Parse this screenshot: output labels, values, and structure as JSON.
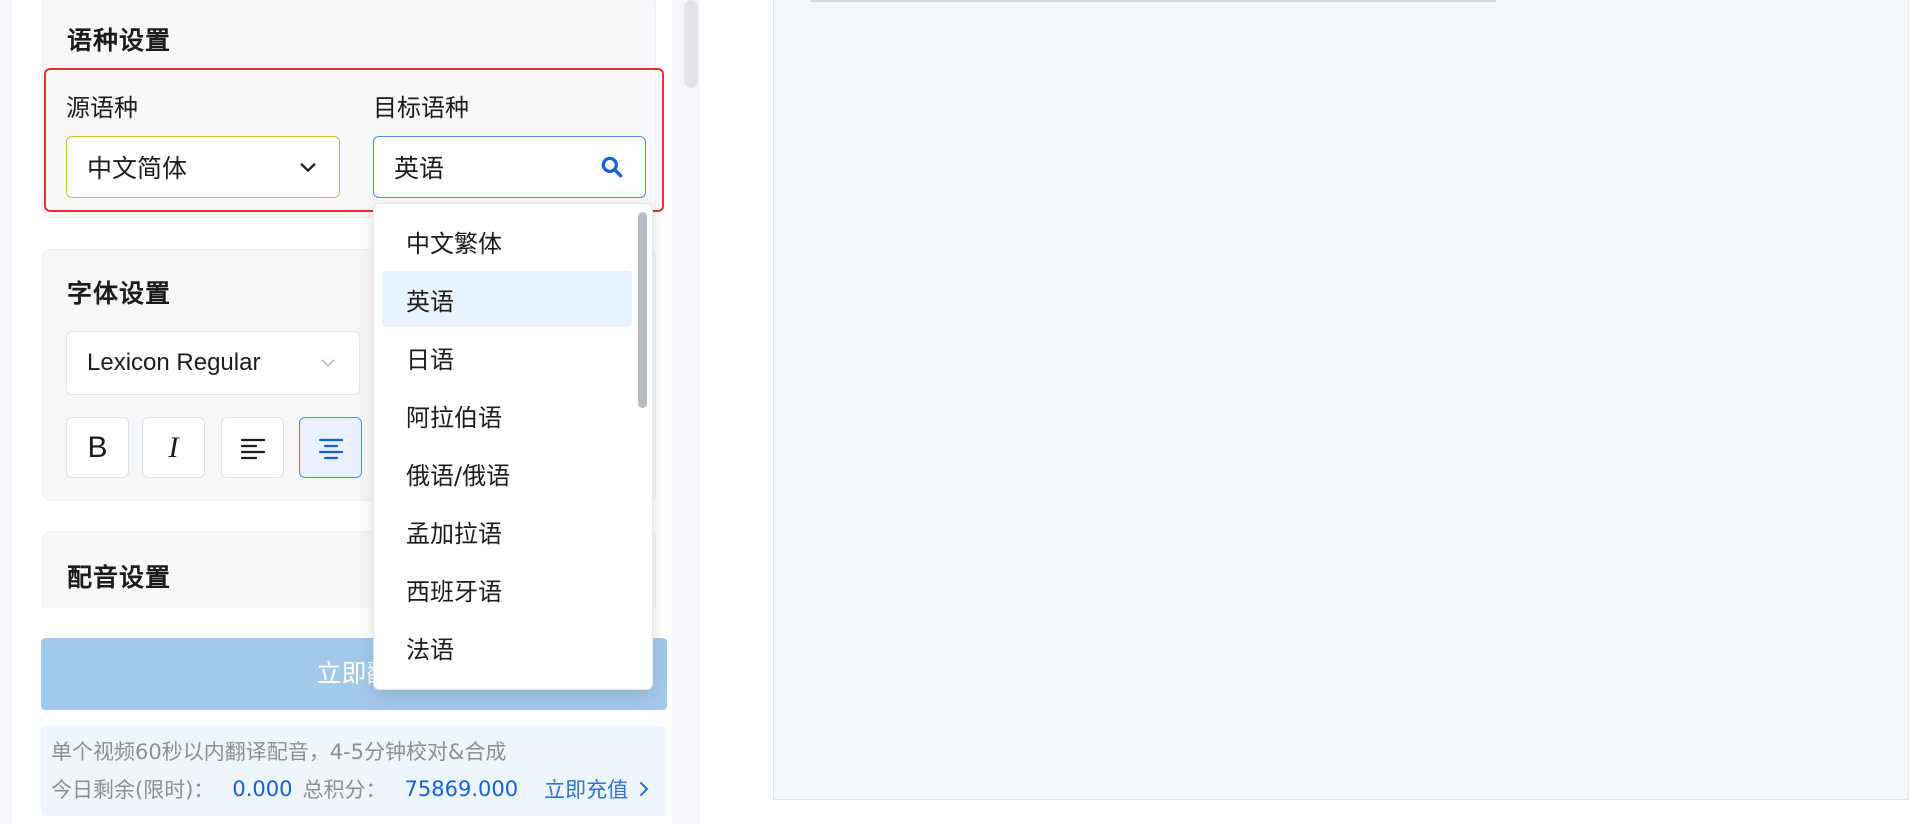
{
  "language_settings": {
    "title": "语种设置",
    "source_label": "源语种",
    "source_value": "中文简体",
    "target_label": "目标语种",
    "target_value": "英语"
  },
  "target_dropdown": {
    "items": [
      "中文繁体",
      "英语",
      "日语",
      "阿拉伯语",
      "俄语/俄语",
      "孟加拉语",
      "西班牙语",
      "法语"
    ],
    "selected": "英语"
  },
  "font_settings": {
    "title": "字体设置",
    "font_value": "Lexicon Regular",
    "bold_label": "B",
    "italic_label": "I"
  },
  "dubbing_settings": {
    "title": "配音设置"
  },
  "primary_button": {
    "label": "立即翻"
  },
  "info": {
    "line1": "单个视频60秒以内翻译配音，4-5分钟校对&合成",
    "remaining_label": "今日剩余(限时)：",
    "remaining_value": "0.000",
    "points_label": "总积分：",
    "points_value": "75869.000",
    "recharge_label": "立即充值"
  },
  "colors": {
    "highlight_red": "#ee2d2d",
    "accent_blue": "#2b72d9",
    "button_disabled_blue": "#a3c9ea",
    "selected_item_bg": "#e9f3fd"
  }
}
